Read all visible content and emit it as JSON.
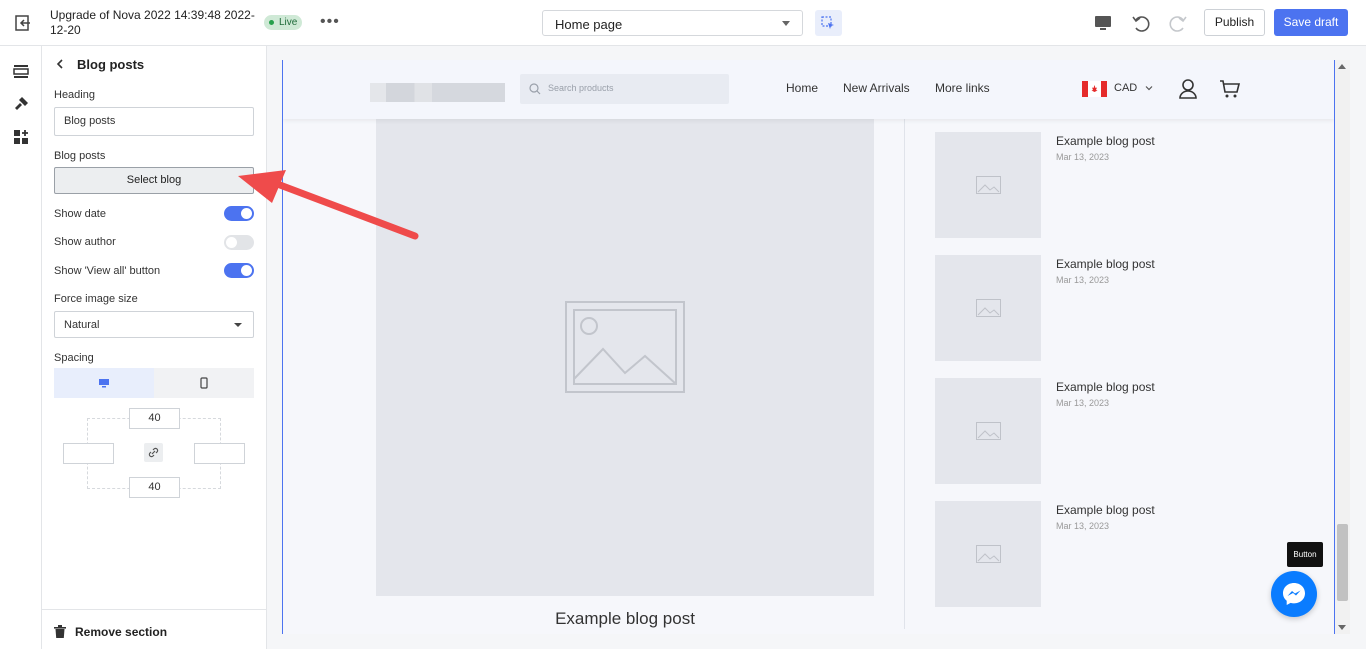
{
  "topbar": {
    "doc_title": "Upgrade of Nova 2022 14:39:48 2022-12-20",
    "status_badge": "Live",
    "more_label": "•••",
    "page_selector": "Home page",
    "publish_label": "Publish",
    "save_label": "Save draft"
  },
  "rail": {
    "icons": [
      "sections-icon",
      "theme-settings-icon",
      "apps-icon"
    ]
  },
  "panel": {
    "title": "Blog posts",
    "heading_label": "Heading",
    "heading_value": "Blog posts",
    "blog_posts_label": "Blog posts",
    "select_blog_label": "Select blog",
    "show_date_label": "Show date",
    "show_date": true,
    "show_author_label": "Show author",
    "show_author": false,
    "show_view_all_label": "Show 'View all' button",
    "show_view_all": true,
    "force_image_size_label": "Force image size",
    "force_image_size_value": "Natural",
    "spacing_label": "Spacing",
    "spacing_top": "40",
    "spacing_bottom": "40",
    "spacing_left": "",
    "spacing_right": "",
    "remove_label": "Remove section"
  },
  "preview": {
    "search_placeholder": "Search products",
    "nav": [
      "Home",
      "New Arrivals",
      "More links"
    ],
    "currency": "CAD",
    "featured_title": "Example blog post",
    "posts": [
      {
        "title": "Example blog post",
        "date": "Mar 13, 2023"
      },
      {
        "title": "Example blog post",
        "date": "Mar 13, 2023"
      },
      {
        "title": "Example blog post",
        "date": "Mar 13, 2023"
      },
      {
        "title": "Example blog post",
        "date": "Mar 13, 2023"
      }
    ]
  },
  "tooltip": "Button",
  "colors": {
    "accent": "#4c73f0",
    "live_badge": "#cfe9d6",
    "annotation_arrow": "#ef4b4b",
    "messenger": "#0a7cff"
  }
}
